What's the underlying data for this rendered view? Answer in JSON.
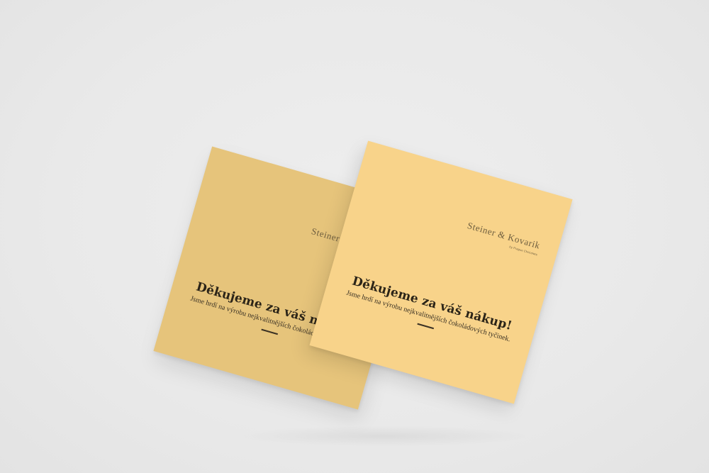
{
  "cards": {
    "back": {
      "brand_name": "Steiner & Kovarik",
      "brand_sub": "by Prague Chocolate",
      "headline": "Děkujeme za váš nákup!",
      "subline": "Jsme hrdí na výrobu nejkvalitnějších čokoládových tyčinek.",
      "color": "#e6c47b"
    },
    "front": {
      "brand_name": "Steiner & Kovarik",
      "brand_sub": "by Prague Chocolate",
      "headline": "Děkujeme za váš nákup!",
      "subline": "Jsme hrdí na výrobu nejkvalitnějších čokoládových tyčinek.",
      "color": "#f8d38a"
    }
  },
  "background_color": "#ececec"
}
